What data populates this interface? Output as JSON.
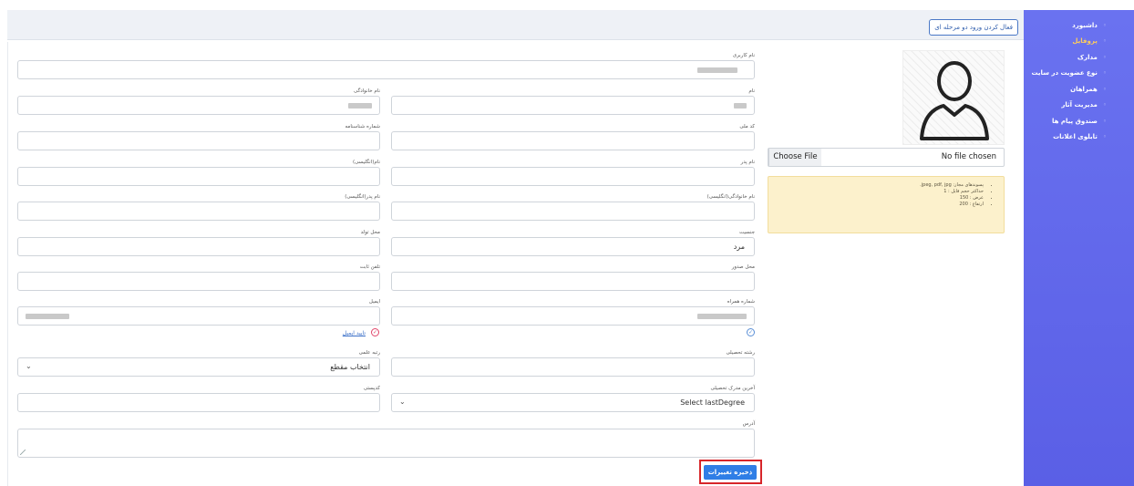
{
  "sidebar": {
    "items": [
      {
        "label": "داشبورد",
        "active": false
      },
      {
        "label": "پروفایل",
        "active": true
      },
      {
        "label": "مدارک",
        "active": false
      },
      {
        "label": "نوع عضویت در سایت",
        "active": false
      },
      {
        "label": "همراهان",
        "active": false
      },
      {
        "label": "مدیریت آثار",
        "active": false
      },
      {
        "label": "صندوق پیام ها",
        "active": false
      },
      {
        "label": "تابلوی اعلانات",
        "active": false
      }
    ]
  },
  "header": {
    "two_factor_button": "فعال کردن ورود دو مرحله ای"
  },
  "avatar": {
    "file_button": "Choose File",
    "file_status": "No file chosen",
    "rules": [
      "پسوندهای مجاز: jpeg, pdf, jpg.",
      "حداکثر حجم فایل : 1",
      "عرض : 150",
      "ارتفاع : 200"
    ]
  },
  "form": {
    "username_label": "نام کاربری",
    "first_name_label": "نام",
    "last_name_label": "نام خانوادگی",
    "national_code_label": "کد ملی",
    "id_number_label": "شماره شناسنامه",
    "father_name_label": "نام پدر",
    "name_en_label": "نام(انگلیسی)",
    "last_name_en_label": "نام خانوادگی(انگلیسی)",
    "father_name_en_label": "نام پدر(انگلیسی)",
    "gender_label": "جنسیت",
    "gender_value": "مرد",
    "birth_place_label": "محل تولد",
    "issue_place_label": "محل صدور",
    "phone_label": "تلفن ثابت",
    "mobile_label": "شماره همراه",
    "email_label": "ایمیل",
    "verify_email_link": "تایید ایمیل",
    "field_of_study_label": "رشته تحصیلی",
    "academic_rank_label": "رتبه علمی",
    "academic_rank_value": "انتخاب مقطع",
    "last_degree_label": "آخرین مدرک تحصیلی",
    "last_degree_value": "Select lastDegree",
    "postal_code_label": "کدپستی",
    "address_label": "آدرس",
    "save_button": "ذخیره تغییرات"
  }
}
